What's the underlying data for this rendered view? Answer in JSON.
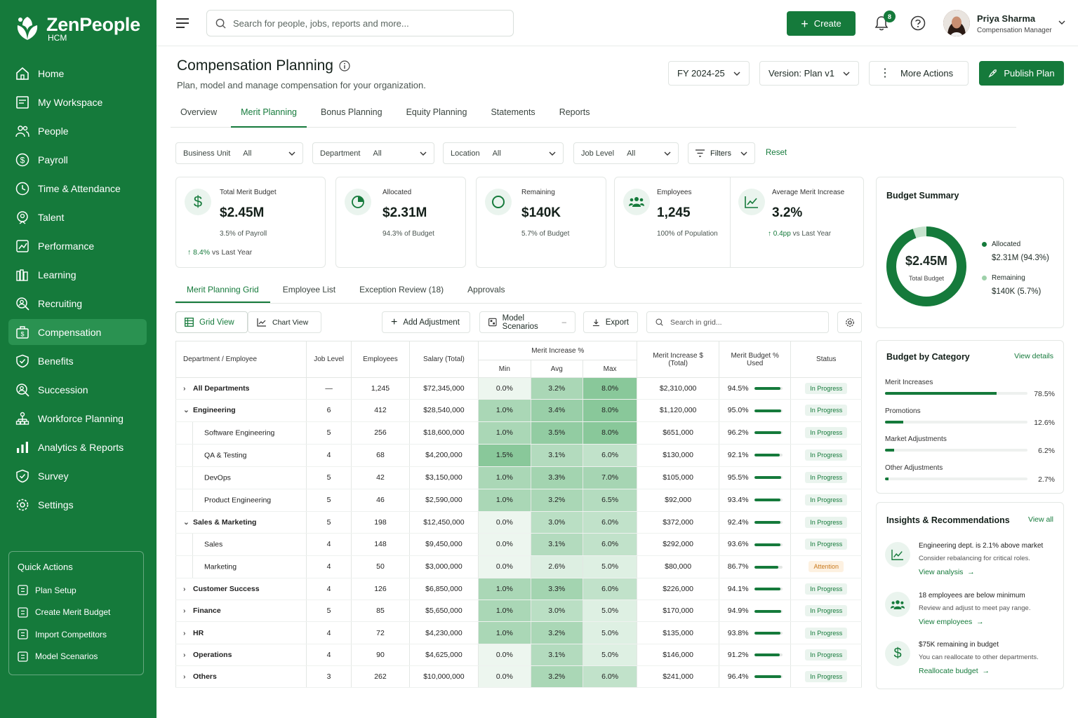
{
  "brand": {
    "name": "ZenPeople",
    "sub": "HCM"
  },
  "nav": [
    {
      "label": "Home",
      "icon": "home-icon"
    },
    {
      "label": "My Workspace",
      "icon": "workspace-icon"
    },
    {
      "label": "People",
      "icon": "people-icon"
    },
    {
      "label": "Payroll",
      "icon": "dollar-icon"
    },
    {
      "label": "Time & Attendance",
      "icon": "clock-icon"
    },
    {
      "label": "Talent",
      "icon": "badge-icon"
    },
    {
      "label": "Performance",
      "icon": "performance-icon"
    },
    {
      "label": "Learning",
      "icon": "books-icon"
    },
    {
      "label": "Recruiting",
      "icon": "search-person-icon"
    },
    {
      "label": "Compensation",
      "icon": "compensation-icon"
    },
    {
      "label": "Benefits",
      "icon": "shield-icon"
    },
    {
      "label": "Succession",
      "icon": "succession-icon"
    },
    {
      "label": "Workforce Planning",
      "icon": "org-icon"
    },
    {
      "label": "Analytics & Reports",
      "icon": "bar-chart-icon"
    },
    {
      "label": "Survey",
      "icon": "survey-icon"
    },
    {
      "label": "Settings",
      "icon": "gear-icon"
    }
  ],
  "quick_actions": {
    "title": "Quick Actions",
    "items": [
      "Plan Setup",
      "Create Merit Budget",
      "Import Competitors",
      "Model Scenarios"
    ]
  },
  "topbar": {
    "search_placeholder": "Search for people, jobs, reports and more...",
    "create": "Create",
    "notif_count": "8",
    "user_name": "Priya Sharma",
    "user_role": "Compensation Manager"
  },
  "header": {
    "title": "Compensation Planning",
    "subtitle": "Plan, model and manage compensation for your organization.",
    "fy": "FY 2024-25",
    "version": "Version: Plan v1",
    "more": "More Actions",
    "publish": "Publish Plan"
  },
  "tabs": [
    "Overview",
    "Merit Planning",
    "Bonus Planning",
    "Equity Planning",
    "Statements",
    "Reports"
  ],
  "filters": [
    {
      "label": "Business Unit",
      "value": "All"
    },
    {
      "label": "Department",
      "value": "All"
    },
    {
      "label": "Location",
      "value": "All"
    },
    {
      "label": "Job Level",
      "value": "All"
    }
  ],
  "filters_btn": "Filters",
  "reset": "Reset",
  "kpis": [
    {
      "label": "Total Merit Budget",
      "value": "$2.45M",
      "sub": "3.5% of Payroll",
      "delta": "8.4%",
      "delta_text": "vs Last Year"
    },
    {
      "label": "Allocated",
      "value": "$2.31M",
      "sub": "94.3% of Budget"
    },
    {
      "label": "Remaining",
      "value": "$140K",
      "sub": "5.7% of Budget"
    },
    {
      "label": "Employees",
      "value": "1,245",
      "sub": "100% of Population"
    },
    {
      "label": "Average Merit Increase",
      "value": "3.2%",
      "delta": "0.4pp",
      "delta_text": "vs Last Year"
    }
  ],
  "subtabs": [
    "Merit Planning Grid",
    "Employee List",
    "Exception Review (18)",
    "Approvals"
  ],
  "toolbar": {
    "grid": "Grid View",
    "chart": "Chart View",
    "add": "Add Adjustment",
    "model": "Model Scenarios",
    "export": "Export",
    "search_placeholder": "Search in grid..."
  },
  "table": {
    "headers": {
      "dept": "Department / Employee",
      "level": "Job Level",
      "emp": "Employees",
      "salary": "Salary (Total)",
      "merit_pct": "Merit Increase %",
      "min": "Min",
      "avg": "Avg",
      "max": "Max",
      "merit_amt": "Merit Increase $ (Total)",
      "budget_used": "Merit Budget % Used",
      "status": "Status"
    },
    "rows": [
      {
        "name": "All Departments",
        "level": "—",
        "emp": "1,245",
        "salary": "$72,345,000",
        "min": "0.0%",
        "avg": "3.2%",
        "max": "8.0%",
        "amt": "$2,310,000",
        "used": "94.5%",
        "used_v": 94.5,
        "status": "In Progress",
        "kind": "top",
        "exp": "›"
      },
      {
        "name": "Engineering",
        "level": "6",
        "emp": "412",
        "salary": "$28,540,000",
        "min": "1.0%",
        "avg": "3.4%",
        "max": "8.0%",
        "amt": "$1,120,000",
        "used": "95.0%",
        "used_v": 95,
        "status": "In Progress",
        "kind": "top",
        "exp": "⌄"
      },
      {
        "name": "Software Engineering",
        "level": "5",
        "emp": "256",
        "salary": "$18,600,000",
        "min": "1.0%",
        "avg": "3.5%",
        "max": "8.0%",
        "amt": "$651,000",
        "used": "96.2%",
        "used_v": 96.2,
        "status": "In Progress",
        "kind": "child"
      },
      {
        "name": "QA & Testing",
        "level": "4",
        "emp": "68",
        "salary": "$4,200,000",
        "min": "1.5%",
        "avg": "3.1%",
        "max": "6.0%",
        "amt": "$130,000",
        "used": "92.1%",
        "used_v": 92.1,
        "status": "In Progress",
        "kind": "child"
      },
      {
        "name": "DevOps",
        "level": "5",
        "emp": "42",
        "salary": "$3,150,000",
        "min": "1.0%",
        "avg": "3.3%",
        "max": "7.0%",
        "amt": "$105,000",
        "used": "95.5%",
        "used_v": 95.5,
        "status": "In Progress",
        "kind": "child"
      },
      {
        "name": "Product Engineering",
        "level": "5",
        "emp": "46",
        "salary": "$2,590,000",
        "min": "1.0%",
        "avg": "3.2%",
        "max": "6.5%",
        "amt": "$92,000",
        "used": "93.4%",
        "used_v": 93.4,
        "status": "In Progress",
        "kind": "child"
      },
      {
        "name": "Sales & Marketing",
        "level": "5",
        "emp": "198",
        "salary": "$12,450,000",
        "min": "0.0%",
        "avg": "3.0%",
        "max": "6.0%",
        "amt": "$372,000",
        "used": "92.4%",
        "used_v": 92.4,
        "status": "In Progress",
        "kind": "top",
        "exp": "⌄"
      },
      {
        "name": "Sales",
        "level": "4",
        "emp": "148",
        "salary": "$9,450,000",
        "min": "0.0%",
        "avg": "3.1%",
        "max": "6.0%",
        "amt": "$292,000",
        "used": "93.6%",
        "used_v": 93.6,
        "status": "In Progress",
        "kind": "child"
      },
      {
        "name": "Marketing",
        "level": "4",
        "emp": "50",
        "salary": "$3,000,000",
        "min": "0.0%",
        "avg": "2.6%",
        "max": "5.0%",
        "amt": "$80,000",
        "used": "86.7%",
        "used_v": 86.7,
        "status": "Attention",
        "kind": "child"
      },
      {
        "name": "Customer Success",
        "level": "4",
        "emp": "126",
        "salary": "$6,850,000",
        "min": "1.0%",
        "avg": "3.3%",
        "max": "6.0%",
        "amt": "$226,000",
        "used": "94.1%",
        "used_v": 94.1,
        "status": "In Progress",
        "kind": "top",
        "exp": "›"
      },
      {
        "name": "Finance",
        "level": "5",
        "emp": "85",
        "salary": "$5,650,000",
        "min": "1.0%",
        "avg": "3.0%",
        "max": "5.0%",
        "amt": "$170,000",
        "used": "94.9%",
        "used_v": 94.9,
        "status": "In Progress",
        "kind": "top",
        "exp": "›"
      },
      {
        "name": "HR",
        "level": "4",
        "emp": "72",
        "salary": "$4,230,000",
        "min": "1.0%",
        "avg": "3.2%",
        "max": "5.0%",
        "amt": "$135,000",
        "used": "93.8%",
        "used_v": 93.8,
        "status": "In Progress",
        "kind": "top",
        "exp": "›"
      },
      {
        "name": "Operations",
        "level": "4",
        "emp": "90",
        "salary": "$4,625,000",
        "min": "0.0%",
        "avg": "3.1%",
        "max": "5.0%",
        "amt": "$146,000",
        "used": "91.2%",
        "used_v": 91.2,
        "status": "In Progress",
        "kind": "top",
        "exp": "›"
      },
      {
        "name": "Others",
        "level": "3",
        "emp": "262",
        "salary": "$10,000,000",
        "min": "0.0%",
        "avg": "3.2%",
        "max": "6.0%",
        "amt": "$241,000",
        "used": "96.4%",
        "used_v": 96.4,
        "status": "In Progress",
        "kind": "top",
        "exp": "›"
      }
    ]
  },
  "budget_summary": {
    "title": "Budget Summary",
    "total": "$2.45M",
    "total_label": "Total Budget",
    "allocated_label": "Allocated",
    "allocated_value": "$2.31M (94.3%)",
    "allocated_fraction": 0.943,
    "remaining_label": "Remaining",
    "remaining_value": "$140K (5.7%)"
  },
  "categories": {
    "title": "Budget by Category",
    "link": "View details",
    "items": [
      {
        "label": "Merit Increases",
        "pct": "78.5%",
        "v": 78.5
      },
      {
        "label": "Promotions",
        "pct": "12.6%",
        "v": 12.6
      },
      {
        "label": "Market Adjustments",
        "pct": "6.2%",
        "v": 6.2
      },
      {
        "label": "Other Adjustments",
        "pct": "2.7%",
        "v": 2.7
      }
    ]
  },
  "insights": {
    "title": "Insights & Recommendations",
    "link": "View all",
    "items": [
      {
        "title": "Engineering dept. is 2.1% above market",
        "sub": "Consider rebalancing for critical roles.",
        "link": "View analysis"
      },
      {
        "title": "18 employees are below minimum",
        "sub": "Review and adjust to meet pay range.",
        "link": "View employees"
      },
      {
        "title": "$75K remaining in budget",
        "sub": "You can reallocate to other departments.",
        "link": "Reallocate budget"
      }
    ]
  },
  "colors": {
    "brand": "#157a3b",
    "attention": "#c9791c"
  }
}
